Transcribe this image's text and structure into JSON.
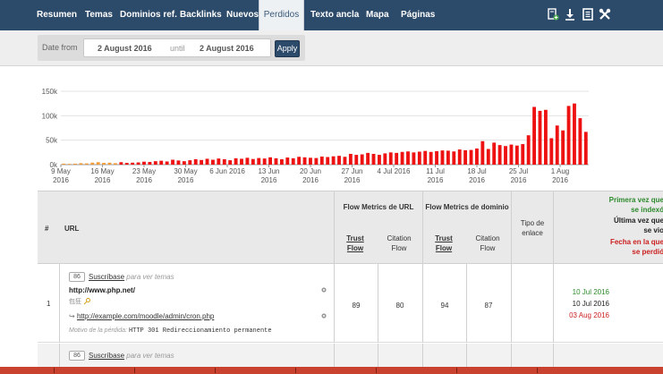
{
  "nav": {
    "tabs": [
      {
        "label": "Resumen"
      },
      {
        "label": "Temas"
      },
      {
        "label": "Dominios ref."
      },
      {
        "label": "Backlinks"
      },
      {
        "label": "Nuevos"
      },
      {
        "label": "Perdidos"
      },
      {
        "label": "Texto ancla"
      },
      {
        "label": "Mapa"
      },
      {
        "label": "Páginas"
      }
    ],
    "active_tab": "Perdidos",
    "icons": [
      "bookmark-add-icon",
      "download-icon",
      "report-icon",
      "tools-icon"
    ]
  },
  "date_filter": {
    "label": "Date from",
    "from": "2 August 2016",
    "until_label": "until",
    "to": "2 August 2016",
    "apply_label": "Apply"
  },
  "chart_data": {
    "type": "bar",
    "y_ticks": [
      "0k",
      "50k",
      "100k",
      "150k"
    ],
    "ylim": [
      0,
      150000
    ],
    "x_tick_labels": [
      [
        "9 May",
        "2016"
      ],
      [
        "16 May",
        "2016"
      ],
      [
        "23 May",
        "2016"
      ],
      [
        "30 May",
        "2016"
      ],
      [
        "6 Jun 2016",
        ""
      ],
      [
        "13 Jun",
        "2016"
      ],
      [
        "20 Jun",
        "2016"
      ],
      [
        "27 Jun",
        "2016"
      ],
      [
        "4 Jul 2016",
        ""
      ],
      [
        "11 Jul",
        "2016"
      ],
      [
        "18 Jul",
        "2016"
      ],
      [
        "25 Jul",
        "2016"
      ],
      [
        "1 Aug",
        "2016"
      ]
    ],
    "series": [
      {
        "color": "#ee1111",
        "values": [
          2000,
          1500,
          2000,
          3000,
          2500,
          4000,
          5000,
          3500,
          4000,
          3000,
          5000,
          3500,
          4000,
          4500,
          6000,
          5500,
          7000,
          8000,
          6500,
          10000,
          8500,
          7000,
          9000,
          11000,
          9500,
          12000,
          10000,
          12500,
          11000,
          9000,
          13000,
          12000,
          14000,
          11500,
          13500,
          12500,
          15000,
          13000,
          11000,
          14500,
          13000,
          16000,
          15000,
          14000,
          13500,
          16500,
          15500,
          17000,
          18000,
          16000,
          22000,
          20000,
          21000,
          24000,
          22000,
          20000,
          23000,
          25000,
          24000,
          26000,
          27000,
          25000,
          26500,
          28000,
          26000,
          27500,
          29000,
          28500,
          27000,
          31000,
          29500,
          30000,
          33000,
          48000,
          32000,
          45000,
          40000,
          38000,
          41000,
          39000,
          42000,
          60000,
          118000,
          110000,
          112000,
          54000,
          80000,
          70000,
          120000,
          125000,
          95000,
          67000
        ]
      }
    ]
  },
  "table": {
    "headers": {
      "index": "#",
      "url": "URL",
      "url_flow_group": "Flow Metrics de URL",
      "domain_flow_group": "Flow Metrics de dominio",
      "trust_flow": [
        "Trust",
        "Flow"
      ],
      "citation_flow": [
        "Citation",
        "Flow"
      ],
      "link_type": [
        "Tipo de",
        "enlace"
      ],
      "first_indexed": [
        "Primera vez que",
        "se indexó"
      ],
      "last_seen": [
        "Última vez que",
        "se vio"
      ],
      "lost_date": [
        "Fecha en la que",
        "se perdió"
      ]
    },
    "rows": [
      {
        "index": "1",
        "topic_score": "86",
        "subscribe_link": "Suscríbase",
        "subscribe_suffix": "para ver temas",
        "source_url": "http://www.php.net/",
        "source_meta": "包狂",
        "target_url": "http://example.com/moodle/admin/cron.php",
        "loss_reason_label": "Motivo de la pérdida:",
        "loss_reason": "HTTP 301 Redireccionamiento permanente",
        "url_trust_flow": "89",
        "url_citation_flow": "80",
        "domain_trust_flow": "94",
        "domain_citation_flow": "87",
        "link_type": "",
        "first_indexed": "10 Jul 2016",
        "last_seen": "10 Jul 2016",
        "lost_date": "03 Aug 2016"
      },
      {
        "index": "",
        "topic_score": "86",
        "subscribe_link": "Suscríbase",
        "subscribe_suffix": "para ver temas"
      }
    ]
  }
}
